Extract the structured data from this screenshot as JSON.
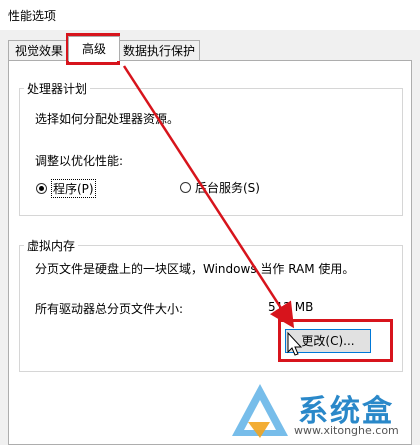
{
  "window": {
    "title": "性能选项"
  },
  "tabs": [
    {
      "label": "视觉效果"
    },
    {
      "label": "高级"
    },
    {
      "label": "数据执行保护"
    }
  ],
  "processor": {
    "legend": "处理器计划",
    "desc": "选择如何分配处理器资源。",
    "adjust_label": "调整以优化性能:",
    "option_programs": "程序(P)",
    "option_services": "后台服务(S)"
  },
  "vm": {
    "legend": "虚拟内存",
    "desc": "分页文件是硬盘上的一块区域，Windows 当作 RAM 使用。",
    "total_label": "所有驱动器总分页文件大小:",
    "total_value": "512 MB",
    "change_button": "更改(C)..."
  },
  "watermark": {
    "name": "系统盒",
    "url": "www.xitonghe.com"
  },
  "colors": {
    "highlight": "#d7141c",
    "accent": "#0078d7"
  }
}
